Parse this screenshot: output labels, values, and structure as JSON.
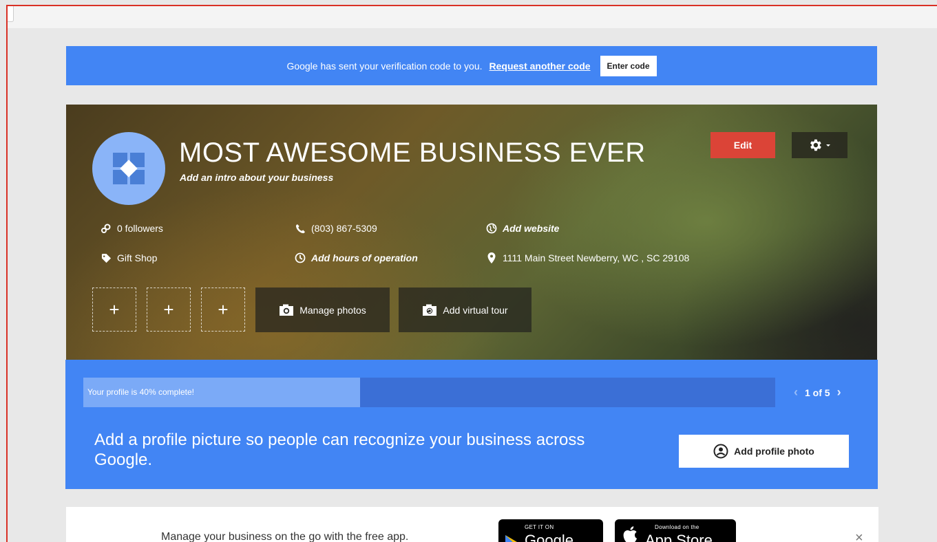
{
  "verification": {
    "message": "Google has sent your verification code to you.",
    "request_link": "Request another code",
    "enter_code_button": "Enter code"
  },
  "business": {
    "name": "MOST AWESOME BUSINESS EVER",
    "intro": "Add an intro about your business",
    "edit_button": "Edit",
    "followers": "0 followers",
    "phone": "(803) 867-5309",
    "website": "Add website",
    "category": "Gift Shop",
    "hours": "Add hours of operation",
    "address": "1111 Main Street Newberry, WC , SC 29108",
    "add_photo_slots": [
      "+",
      "+",
      "+"
    ],
    "manage_photos_button": "Manage photos",
    "virtual_tour_button": "Add virtual tour"
  },
  "completion": {
    "progress_text": "Your profile is 40% complete!",
    "progress_percent": 40,
    "pager_text": "1 of 5",
    "suggestion": "Add a profile picture so people can recognize your business across Google.",
    "add_profile_photo_button": "Add profile photo"
  },
  "promo": {
    "text": "Manage your business on the go with the free app.",
    "google_play_small": "GET IT ON",
    "google_play_big": "Google play",
    "app_store_small": "Download on the",
    "app_store_big": "App Store",
    "close_label": "×"
  },
  "colors": {
    "google_blue": "#4285f4",
    "edit_red": "#db4437",
    "progress_fill": "#7baaf7"
  }
}
